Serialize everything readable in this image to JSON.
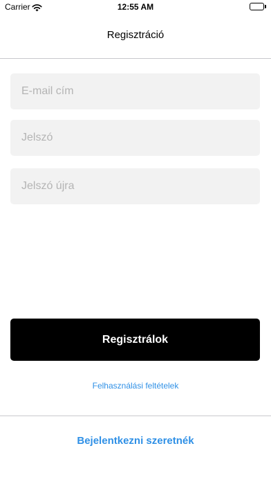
{
  "status_bar": {
    "carrier": "Carrier",
    "time": "12:55 AM",
    "icons": [
      "wifi-icon",
      "battery-icon"
    ]
  },
  "nav": {
    "title": "Regisztráció"
  },
  "form": {
    "email": {
      "value": "",
      "placeholder": "E-mail cím"
    },
    "password": {
      "value": "",
      "placeholder": "Jelszó"
    },
    "password_again": {
      "value": "",
      "placeholder": "Jelszó újra"
    }
  },
  "actions": {
    "register_label": "Regisztrálok",
    "terms_label": "Felhasználási feltételek",
    "login_label": "Bejelentkezni szeretnék"
  },
  "colors": {
    "accent": "#2f90e6",
    "button_background": "#000000",
    "field_background": "#f2f2f2",
    "placeholder": "#b4b4b4",
    "divider": "#c8c8cc"
  }
}
